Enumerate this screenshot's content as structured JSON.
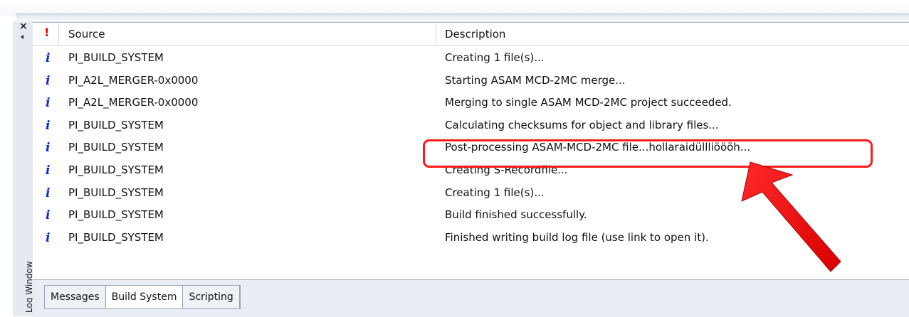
{
  "log_window": {
    "title": "Log Window",
    "close_glyph": "×",
    "header": {
      "severity_glyph": "!",
      "source": "Source",
      "description": "Description"
    },
    "rows": [
      {
        "icon": "i",
        "source": "PI_BUILD_SYSTEM",
        "description": "Creating 1 file(s)..."
      },
      {
        "icon": "i",
        "source": "PI_A2L_MERGER-0x0000",
        "description": "Starting ASAM MCD-2MC merge..."
      },
      {
        "icon": "i",
        "source": "PI_A2L_MERGER-0x0000",
        "description": "Merging to single ASAM MCD-2MC project succeeded."
      },
      {
        "icon": "i",
        "source": "PI_BUILD_SYSTEM",
        "description": "Calculating checksums for object and library files..."
      },
      {
        "icon": "i",
        "source": "PI_BUILD_SYSTEM",
        "description": "Post-processing ASAM-MCD-2MC file...hollaraidüllliöööh..."
      },
      {
        "icon": "i",
        "source": "PI_BUILD_SYSTEM",
        "description": "Creating S-Recordfile..."
      },
      {
        "icon": "i",
        "source": "PI_BUILD_SYSTEM",
        "description": "Creating 1 file(s)..."
      },
      {
        "icon": "i",
        "source": "PI_BUILD_SYSTEM",
        "description": "Build finished successfully."
      },
      {
        "icon": "i",
        "source": "PI_BUILD_SYSTEM",
        "description": "Finished writing build log file (use link to open it)."
      }
    ],
    "tabs": [
      {
        "label": "Messages",
        "active": false
      },
      {
        "label": "Build System",
        "active": true
      },
      {
        "label": "Scripting",
        "active": false
      }
    ]
  },
  "colors": {
    "info_icon": "#0a2ad2",
    "severity_icon": "#e00000",
    "annotation": "#ff1a1a"
  }
}
